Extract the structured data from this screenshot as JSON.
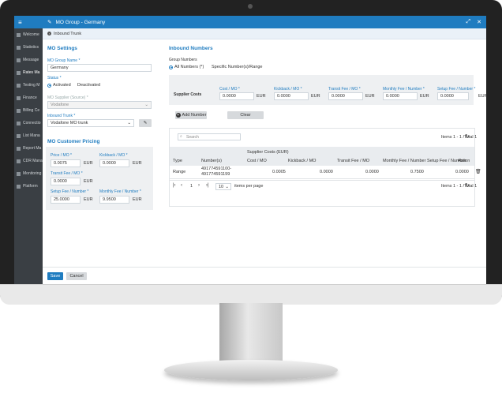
{
  "sidebar": {
    "items": [
      "Welcome",
      "Statistics",
      "Message",
      "Rates Ma",
      "Testing M",
      "Finance",
      "Billing Ce",
      "Connectio",
      "List Mana",
      "Report Ma",
      "CDR Mana",
      "Monitoring",
      "Platform"
    ]
  },
  "modal": {
    "title": "MO Group - Germany",
    "breadcrumb": "Inbound Trunk"
  },
  "mo_settings": {
    "title": "MO Settings",
    "group_name_label": "MO Group Name *",
    "group_name_value": "Germany",
    "status_label": "Status *",
    "status_activated": "Activated",
    "status_deactivated": "Deactivated",
    "supplier_label": "MO Supplier (Source) *",
    "supplier_value": "Vodafone",
    "trunk_label": "Inbound Trunk *",
    "trunk_value": "Vodafone MO trunk"
  },
  "customer_pricing": {
    "title": "MO Customer Pricing",
    "price_label": "Price / MO *",
    "price_value": "0.0075",
    "kickback_label": "Kickback / MO *",
    "kickback_value": "0.0000",
    "transit_label": "Transit Fee / MO *",
    "transit_value": "0.0000",
    "setup_label": "Setup Fee / Number *",
    "setup_value": "25.0000",
    "monthly_label": "Monthly Fee / Number *",
    "monthly_value": "9.9500",
    "unit": "EUR"
  },
  "inbound_numbers": {
    "title": "Inbound Numbers",
    "group_numbers_label": "Group Numbers",
    "option_all": "All Numbers (*)",
    "option_specific": "Specific Number(s)/Range",
    "supplier_costs_label": "Supplier Costs",
    "cost_label": "Cost / MO *",
    "cost_value": "0.0000",
    "kickback_label": "Kickback / MO *",
    "kickback_value": "0.0000",
    "transit_label": "Transit Fee / MO *",
    "transit_value": "0.0000",
    "monthly_label": "Monthly Fee / Number *",
    "monthly_value": "0.0000",
    "setup_label": "Setup Fee / Number *",
    "setup_value": "0.0000",
    "unit": "EUR",
    "add_button": "Add Number",
    "clear_button": "Clear"
  },
  "grid": {
    "search_placeholder": "Search",
    "items_info": "Items 1 - 1 /Total 1",
    "group_header": "Supplier Costs (EUR)",
    "columns": [
      "Type",
      "Number(s)",
      "Cost / MO",
      "Kickback / MO",
      "Transit Fee / MO",
      "Monthly Fee / Number",
      "Setup Fee / Number",
      "Action"
    ],
    "row": {
      "type": "Range",
      "numbers_1": "491774591100-",
      "numbers_2": "491774591199",
      "cost": "0.0005",
      "kickback": "0.0000",
      "transit": "0.0000",
      "monthly": "0.7500",
      "setup": "0.0000"
    },
    "page": "1",
    "page_size": "10",
    "per_page_label": "items per page"
  },
  "footer": {
    "save": "Save",
    "cancel": "Cancel"
  },
  "colors": {
    "accent": "#1f7cc0"
  }
}
